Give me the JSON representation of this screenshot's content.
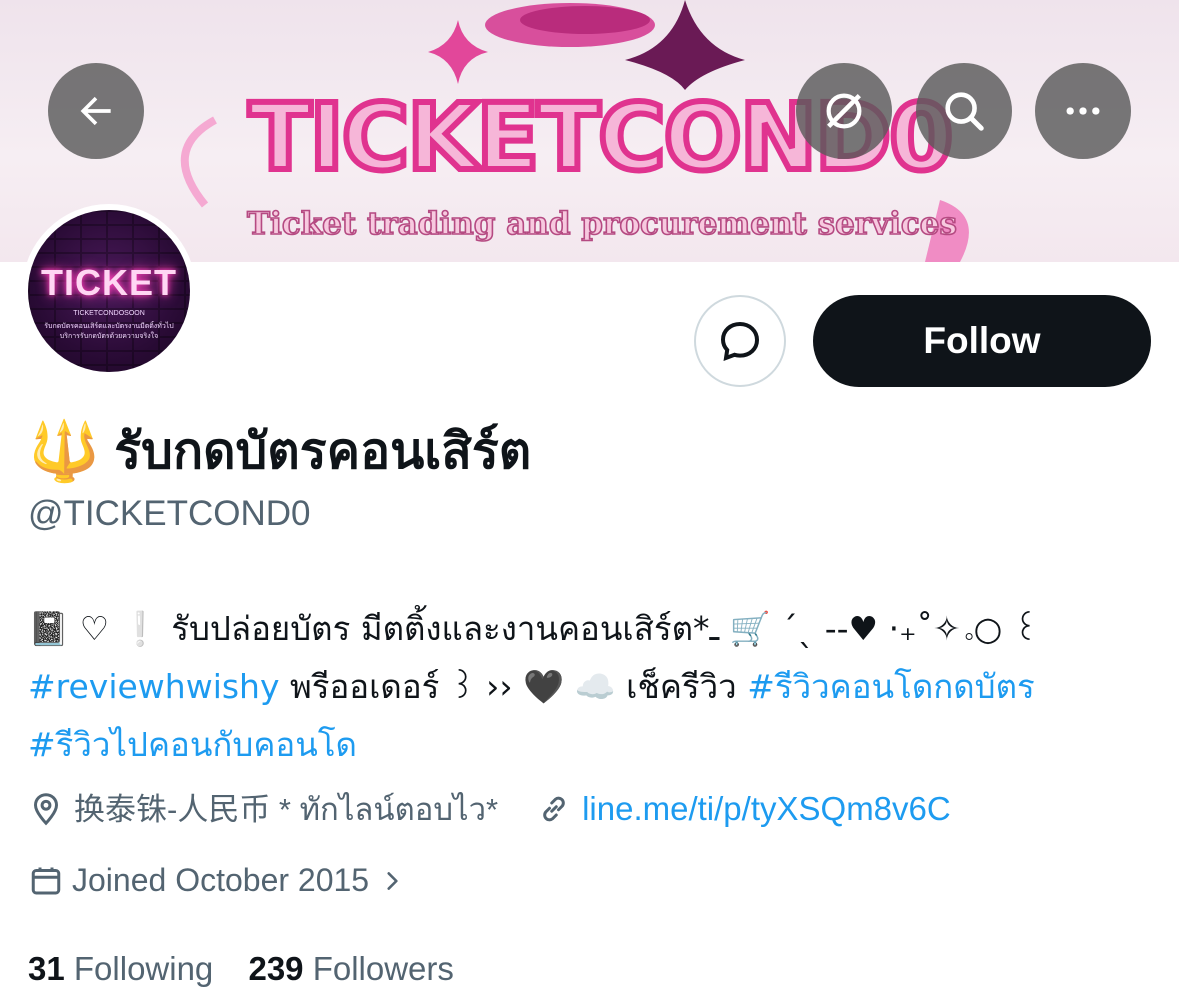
{
  "banner": {
    "title": "TICKETCOND0",
    "subtitle": "Ticket trading and procurement services"
  },
  "nav": {
    "back_icon": "arrow-left-icon",
    "grok_icon": "grok-slash-icon",
    "search_icon": "search-icon",
    "more_icon": "more-horizontal-icon"
  },
  "avatar": {
    "title": "TICKET",
    "line1": "TICKETCONDOSOON",
    "line2": "รับกดบัตรคอนเสิร์ตและบัตรงานมีตติ้งทั่วไป",
    "line3": "บริการรับกดบัตรด้วยความจริงใจ"
  },
  "actions": {
    "follow_label": "Follow",
    "message_icon": "message-bubble-icon"
  },
  "profile": {
    "emoji": "🔱",
    "name": "รับกดบัตรคอนเสิร์ต",
    "handle": "@TICKETCOND0"
  },
  "bio": {
    "line1": "📓 ♡ ❕ รับปล่อยบัตร มีตติ้งและงานคอนเสิร์ต*ـ 🛒 ˊˎ --♥ ·₊˚✧｡○ ꒰",
    "line2_tag1": "#reviewhwishy",
    "line2_text": " พรีออเดอร์ ꒱ ›› 🖤 ☁️ เช็ครีวิว ",
    "line2_tag2": "#รีวิวคอนโดกดบัตร",
    "line3_tag": "#รีวิวไปคอนกับคอนโด"
  },
  "meta": {
    "location": "换泰铢-人民币 * ทักไลน์ตอบไว*",
    "link": "line.me/ti/p/tyXSQm8v6C",
    "joined": "Joined October 2015"
  },
  "stats": {
    "following_count": "31",
    "following_label": "Following",
    "followers_count": "239",
    "followers_label": "Followers"
  }
}
